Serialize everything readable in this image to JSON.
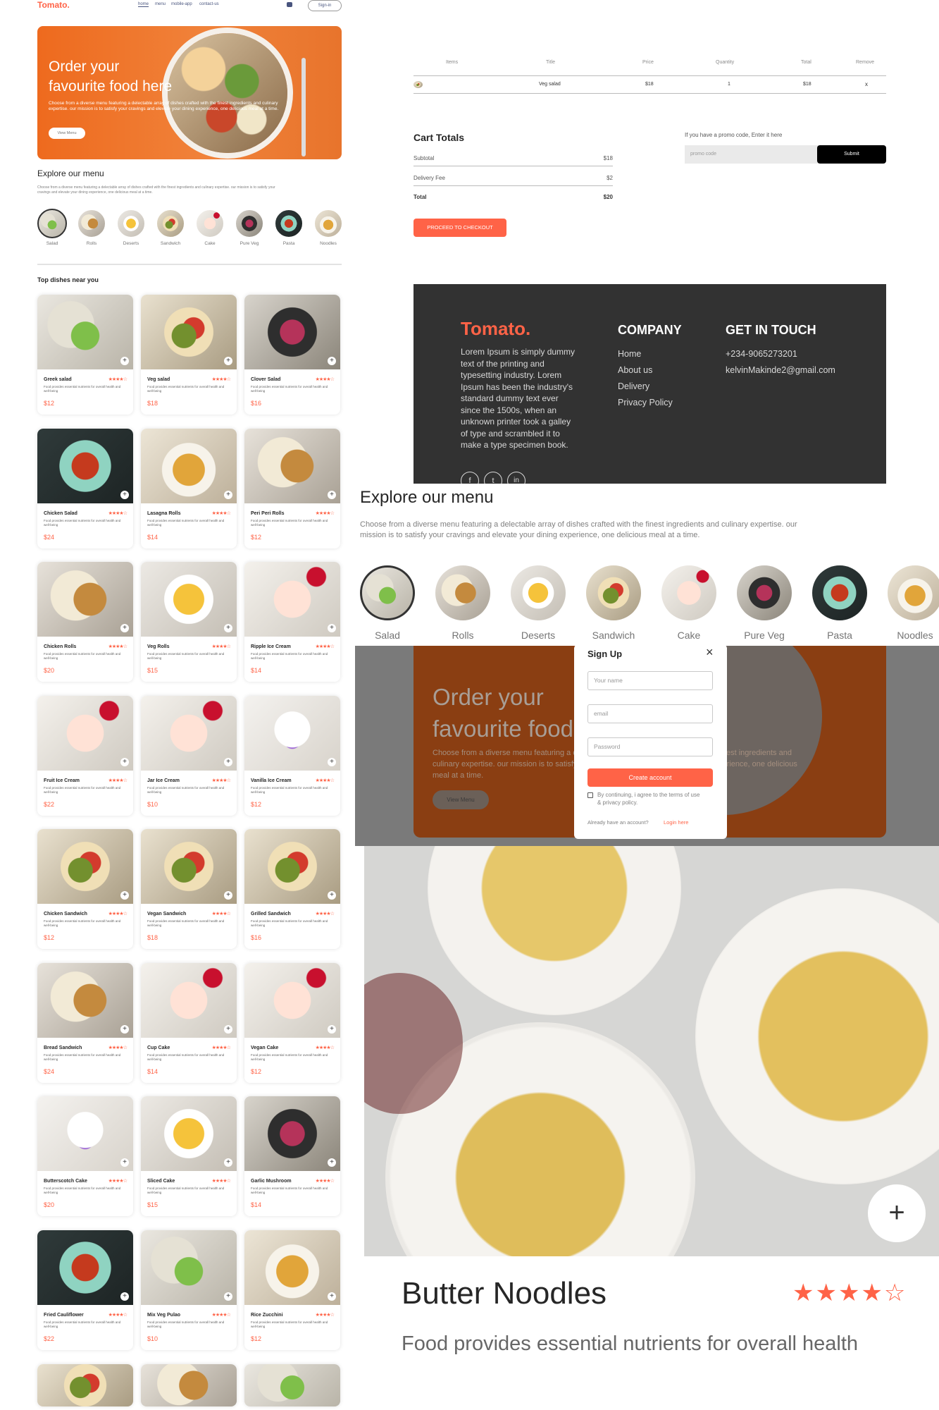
{
  "nav": {
    "logo": "Tomato.",
    "links": [
      "home",
      "menu",
      "mobile-app",
      "contact-us"
    ],
    "signin": "Sign-in"
  },
  "hero": {
    "title_line1": "Order your",
    "title_line2": "favourite food here",
    "desc": "Choose from a diverse menu featuring a delectable array of dishes crafted with the finest ingredients and culinary expertise. our mission is to satisfy your cravings and elevate your dining experience, one delicious meal at a time.",
    "button": "View Menu"
  },
  "explore": {
    "title": "Explore our menu",
    "desc": "Choose from a diverse menu featuring a delectable array of dishes crafted with the finest ingredients and culinary expertise. our mission is to satisfy your cravings and elevate your dining experience, one delicious meal at a time.",
    "categories": [
      "Salad",
      "Rolls",
      "Deserts",
      "Sandwich",
      "Cake",
      "Pure Veg",
      "Pasta",
      "Noodles"
    ]
  },
  "top_dishes": {
    "title": "Top dishes near you",
    "stars": "★★★★☆",
    "desc": "Food provides essential nutrients for overall health and well-being",
    "items": [
      {
        "name": "Greek salad",
        "price": "$12"
      },
      {
        "name": "Veg salad",
        "price": "$18"
      },
      {
        "name": "Clover Salad",
        "price": "$16"
      },
      {
        "name": "Chicken Salad",
        "price": "$24"
      },
      {
        "name": "Lasagna Rolls",
        "price": "$14"
      },
      {
        "name": "Peri Peri Rolls",
        "price": "$12"
      },
      {
        "name": "Chicken Rolls",
        "price": "$20"
      },
      {
        "name": "Veg Rolls",
        "price": "$15"
      },
      {
        "name": "Ripple Ice Cream",
        "price": "$14"
      },
      {
        "name": "Fruit Ice Cream",
        "price": "$22"
      },
      {
        "name": "Jar Ice Cream",
        "price": "$10"
      },
      {
        "name": "Vanilla Ice Cream",
        "price": "$12"
      },
      {
        "name": "Chicken Sandwich",
        "price": "$12"
      },
      {
        "name": "Vegan Sandwich",
        "price": "$18"
      },
      {
        "name": "Grilled Sandwich",
        "price": "$16"
      },
      {
        "name": "Bread Sandwich",
        "price": "$24"
      },
      {
        "name": "Cup Cake",
        "price": "$14"
      },
      {
        "name": "Vegan Cake",
        "price": "$12"
      },
      {
        "name": "Butterscotch Cake",
        "price": "$20"
      },
      {
        "name": "Sliced Cake",
        "price": "$15"
      },
      {
        "name": "Garlic Mushroom",
        "price": "$14"
      },
      {
        "name": "Fried Cauliflower",
        "price": "$22"
      },
      {
        "name": "Mix Veg Pulao",
        "price": "$10"
      },
      {
        "name": "Rice Zucchini",
        "price": "$12"
      }
    ]
  },
  "cart": {
    "headers": [
      "Items",
      "Title",
      "Price",
      "Quantity",
      "Total",
      "Remove"
    ],
    "row": {
      "title": "Veg salad",
      "price": "$18",
      "quantity": "1",
      "total": "$18",
      "remove": "x"
    }
  },
  "totals": {
    "title": "Cart Totals",
    "subtotal_label": "Subtotal",
    "subtotal": "$18",
    "fee_label": "Delivery Fee",
    "fee": "$2",
    "total_label": "Total",
    "total": "$20",
    "checkout": "PROCEED TO CHECKOUT"
  },
  "promo": {
    "label": "If you have a promo code, Enter it here",
    "placeholder": "promo code",
    "submit": "Submit"
  },
  "footer": {
    "logo": "Tomato.",
    "about": "Lorem Ipsum is simply dummy text of the printing and typesetting industry. Lorem Ipsum has been the industry's standard dummy text ever since the 1500s, when an unknown printer took a galley of type and scrambled it to make a type specimen book.",
    "company_title": "COMPANY",
    "company_links": [
      "Home",
      "About us",
      "Delivery",
      "Privacy Policy"
    ],
    "contact_title": "GET IN TOUCH",
    "phone": "+234-9065273201",
    "email": "kelvinMakinde2@gmail.com",
    "socials": [
      "f",
      "t",
      "in"
    ]
  },
  "signup": {
    "title": "Sign Up",
    "close": "×",
    "name_placeholder": "Your name",
    "email_placeholder": "email",
    "password_placeholder": "Password",
    "button": "Create account",
    "terms": "By continuing, i agree to the terms of use & privacy policy.",
    "have_account": "Already have an account?",
    "login": "Login here"
  },
  "detail": {
    "name": "Butter Noodles",
    "stars": "★★★★☆",
    "desc": "Food provides essential nutrients for overall health",
    "plus": "+"
  }
}
